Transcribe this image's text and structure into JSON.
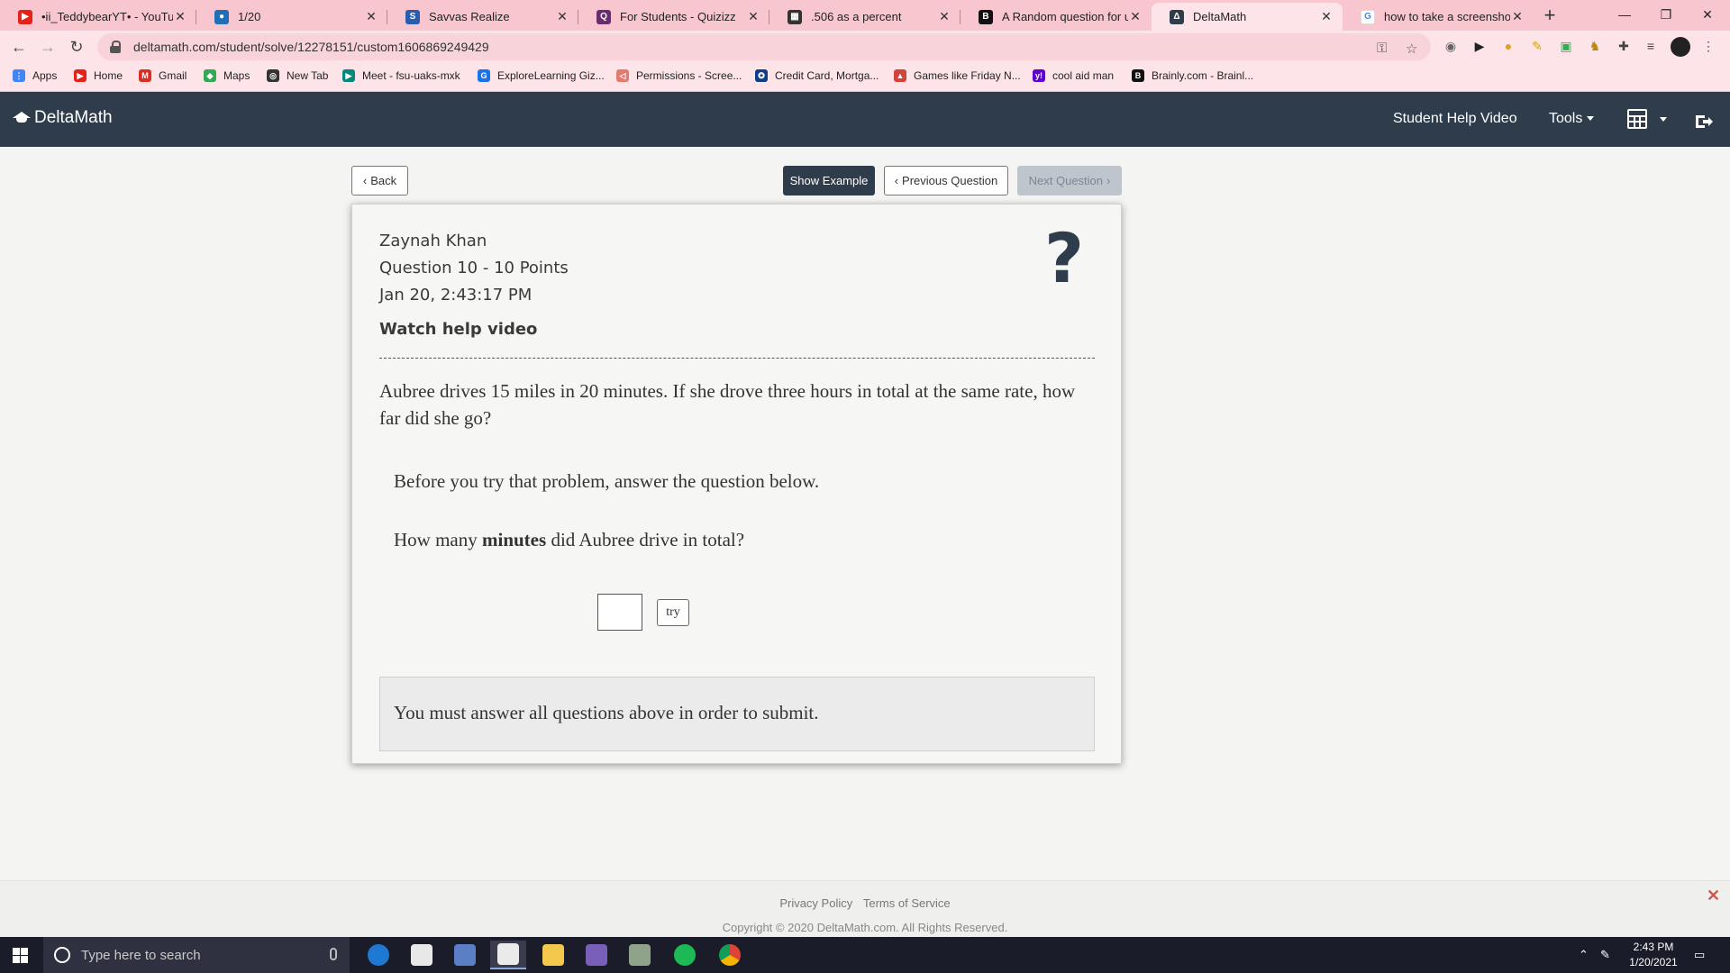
{
  "browser": {
    "tabs": [
      {
        "title": "•ii_TeddybearYT• - YouTube",
        "icon": "youtube-icon",
        "color": "#e62117"
      },
      {
        "title": "1/20",
        "icon": "classroom-icon",
        "color": "#1e6fb8"
      },
      {
        "title": "Savvas Realize",
        "icon": "savvas-icon",
        "color": "#2a5db0"
      },
      {
        "title": "For Students - Quizizz",
        "icon": "quizizz-icon",
        "color": "#6a2c70"
      },
      {
        "title": ".506 as a percent",
        "icon": "calculator-icon",
        "color": "#333333"
      },
      {
        "title": "A Random question for u g...",
        "icon": "brainly-icon",
        "color": "#111111"
      },
      {
        "title": "DeltaMath",
        "icon": "deltamath-icon",
        "color": "#2e3c4c"
      },
      {
        "title": "how to take a screenshot o...",
        "icon": "google-icon",
        "color": "#4285f4"
      }
    ],
    "url": "deltamath.com/student/solve/12278151/custom1606869249429",
    "bookmarks": [
      {
        "label": "Apps",
        "icon": "apps-grid-icon",
        "color": "#4285f4"
      },
      {
        "label": "Home",
        "icon": "youtube-icon",
        "color": "#e62117"
      },
      {
        "label": "Gmail",
        "icon": "gmail-icon",
        "color": "#d93025"
      },
      {
        "label": "Maps",
        "icon": "maps-pin-icon",
        "color": "#34a853"
      },
      {
        "label": "New Tab",
        "icon": "new-tab-icon",
        "color": "#333333"
      },
      {
        "label": "Meet - fsu-uaks-mxk",
        "icon": "meet-icon",
        "color": "#00897b"
      },
      {
        "label": "ExploreLearning Giz...",
        "icon": "explorelearning-icon",
        "color": "#1a73e8"
      },
      {
        "label": "Permissions - Scree...",
        "icon": "permissions-icon",
        "color": "#e37a6f"
      },
      {
        "label": "Credit Card, Mortga...",
        "icon": "bank-icon",
        "color": "#0b3f8a"
      },
      {
        "label": "Games like Friday N...",
        "icon": "games-icon",
        "color": "#d0443a"
      },
      {
        "label": "cool aid man",
        "icon": "yahoo-icon",
        "color": "#5f01d1"
      },
      {
        "label": "Brainly.com - Brainl...",
        "icon": "brainly-icon",
        "color": "#111111"
      }
    ]
  },
  "nav": {
    "brand": "DeltaMath",
    "help_video": "Student Help Video",
    "tools": "Tools"
  },
  "actions": {
    "back": "Back",
    "show_example": "Show Example",
    "previous": "Previous Question",
    "next": "Next Question"
  },
  "question": {
    "student": "Zaynah Khan",
    "number": "Question 10 - 10 Points",
    "timestamp": "Jan 20, 2:43:17 PM",
    "help_link": "Watch help video",
    "problem": "Aubree drives 15 miles in 20 minutes. If she drove three hours in total at the same rate, how far did she go?",
    "prompt": "Before you try that problem, answer the question below.",
    "sub_before": "How many ",
    "sub_bold": "minutes",
    "sub_after": " did Aubree drive in total?",
    "answer_value": "",
    "try": "try",
    "notice": "You must answer all questions above in order to submit."
  },
  "footer": {
    "privacy": "Privacy Policy",
    "terms": "Terms of Service",
    "copyright": "Copyright © 2020 DeltaMath.com. All Rights Reserved."
  },
  "taskbar": {
    "search_placeholder": "Type here to search",
    "time": "2:43 PM",
    "date": "1/20/2021"
  }
}
